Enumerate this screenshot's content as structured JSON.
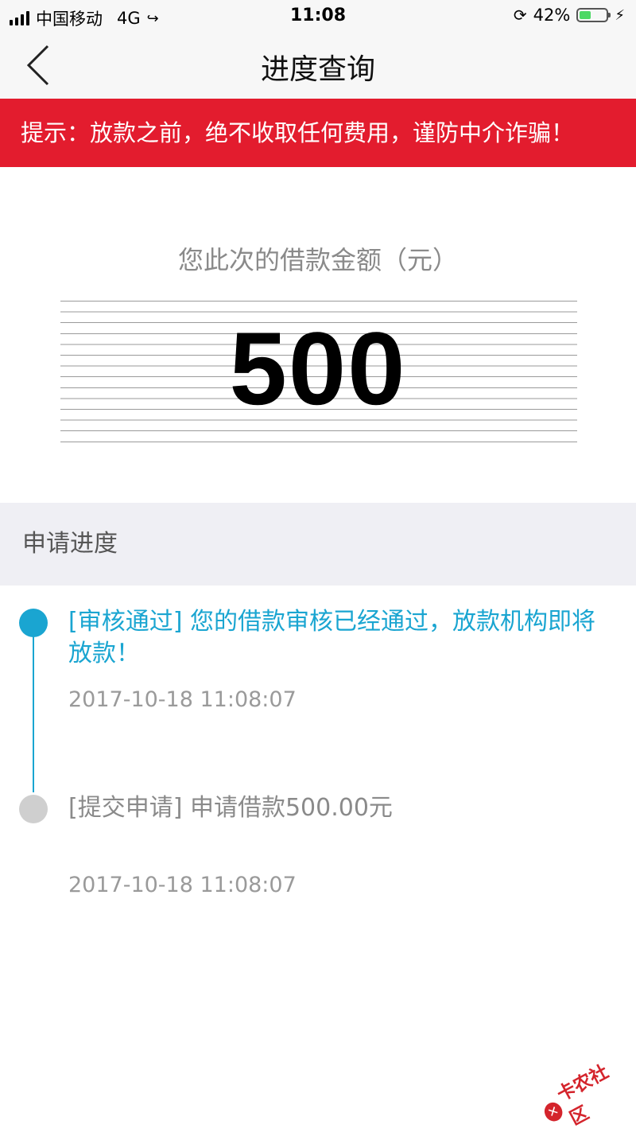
{
  "status_bar": {
    "carrier": "中国移动",
    "network": "4G",
    "time": "11:08",
    "battery_percent": "42%",
    "battery_level": 0.42
  },
  "nav": {
    "title": "进度查询",
    "back_icon": "chevron-left-icon"
  },
  "notice": {
    "text": "提示：放款之前，绝不收取任何费用，谨防中介诈骗！",
    "background": "#e31c2e"
  },
  "loan": {
    "label": "您此次的借款金额（元）",
    "amount": "500"
  },
  "progress": {
    "header": "申请进度",
    "accent_color": "#1aa5d1",
    "steps": [
      {
        "text": "[审核通过] 您的借款审核已经通过，放款机构即将放款！",
        "time": "2017-10-18 11:08:07",
        "state": "active"
      },
      {
        "text": "[提交申请] 申请借款500.00元",
        "time": "2017-10-18 11:08:07",
        "state": "inactive"
      }
    ]
  },
  "watermark": {
    "text": "卡农社区"
  }
}
